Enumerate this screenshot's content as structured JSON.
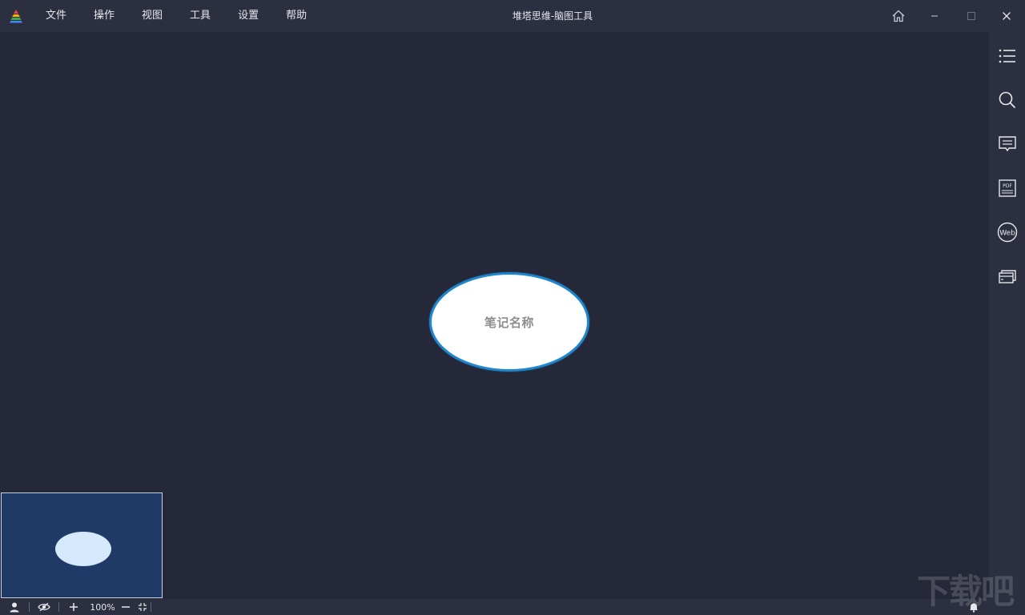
{
  "window": {
    "title": "堆塔思维-脑图工具"
  },
  "menu": {
    "items": [
      {
        "label": "文件"
      },
      {
        "label": "操作"
      },
      {
        "label": "视图"
      },
      {
        "label": "工具"
      },
      {
        "label": "设置"
      },
      {
        "label": "帮助"
      }
    ]
  },
  "window_controls": [
    "home-icon",
    "minimize-icon",
    "maximize-icon",
    "close-icon"
  ],
  "canvas": {
    "root_node_text": "笔记名称"
  },
  "right_toolbar": {
    "buttons": [
      "outline-list-icon",
      "search-icon",
      "comment-icon",
      "pdf-icon",
      "web-icon",
      "cards-icon"
    ]
  },
  "statusbar": {
    "zoom": "100%"
  },
  "colors": {
    "background": "#252838",
    "bars": "#2c2f40",
    "node_border": "#1e87d0",
    "minimap": "#1f3a66"
  },
  "watermark": "下载吧"
}
